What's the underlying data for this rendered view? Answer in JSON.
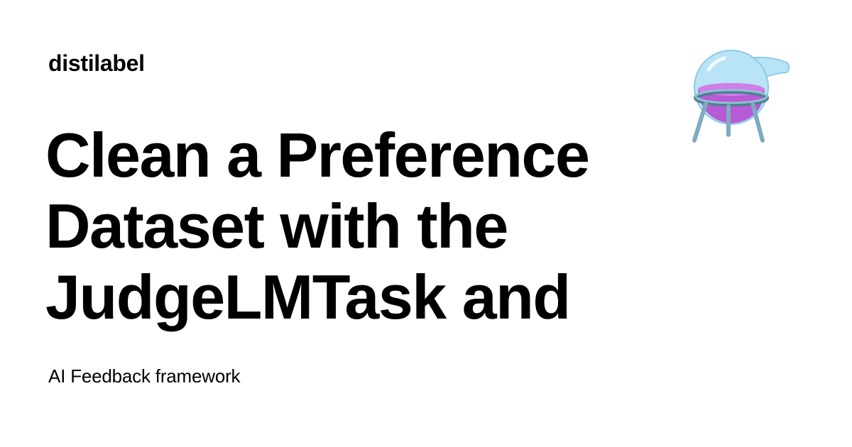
{
  "header": {
    "site_name": "distilabel"
  },
  "main": {
    "title_lines": [
      "Clean a Preference",
      "Dataset with the",
      "JudgeLMTask and"
    ],
    "description": "AI Feedback framework"
  },
  "logo": {
    "icon": "flask-icon",
    "colors": {
      "glass": "#a9dcf3",
      "liquid": "#b65ad6",
      "stand": "#7faac0"
    }
  },
  "colors": {
    "background": "#ffffff",
    "text": "#000000"
  }
}
